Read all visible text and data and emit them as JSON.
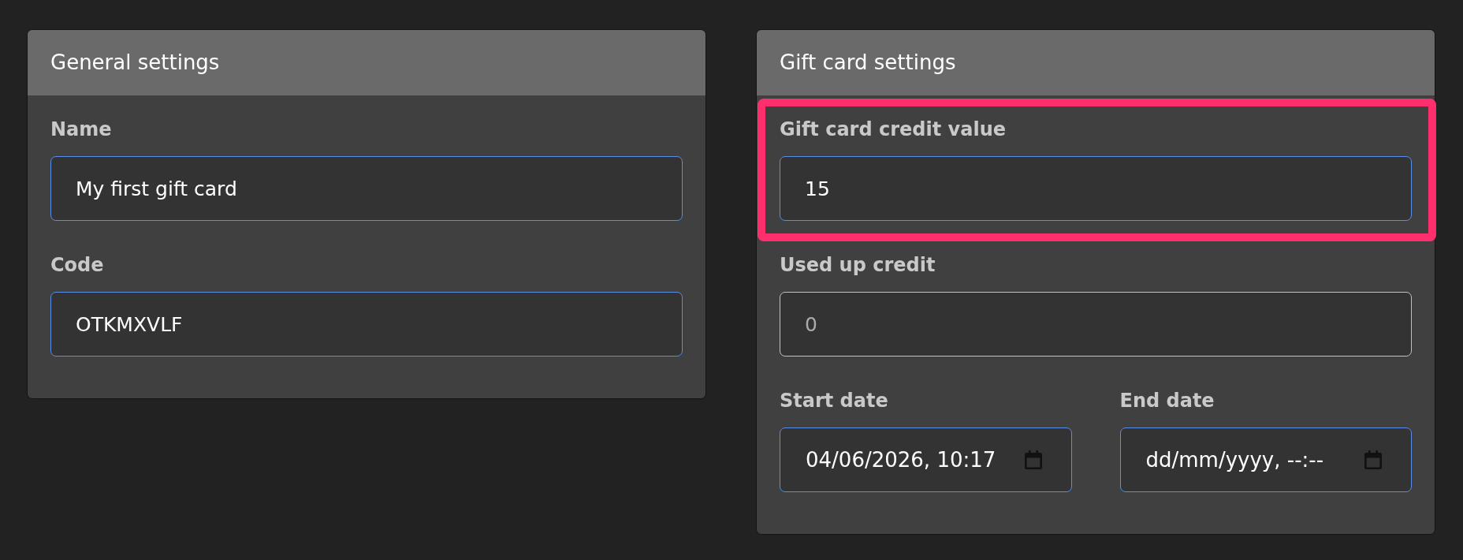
{
  "panels": [
    {
      "title": "General settings",
      "fields": [
        {
          "kind": "text",
          "label": "Name",
          "value": "My first gift card",
          "disabled": false,
          "highlighted": false
        },
        {
          "kind": "text",
          "label": "Code",
          "value": "OTKMXVLF",
          "disabled": false,
          "highlighted": false
        }
      ]
    },
    {
      "title": "Gift card settings",
      "fields": [
        {
          "kind": "text",
          "label": "Gift card credit value",
          "value": "15",
          "disabled": false,
          "highlighted": true
        },
        {
          "kind": "text",
          "label": "Used up credit",
          "value": "0",
          "disabled": true,
          "highlighted": false
        },
        {
          "kind": "datetime",
          "label": "Start date",
          "value": "04/06/2026, 10:17",
          "disabled": false,
          "highlighted": false
        },
        {
          "kind": "datetime",
          "label": "End date",
          "placeholder": "dd/mm/yyyy, --:--",
          "disabled": false,
          "highlighted": false
        }
      ]
    }
  ]
}
